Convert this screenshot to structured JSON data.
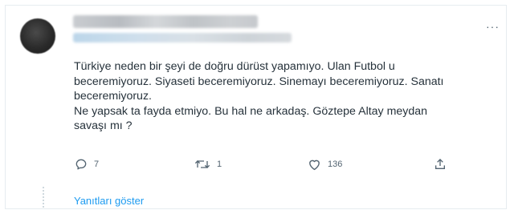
{
  "tweet": {
    "more_icon_glyph": "···",
    "text_lines": [
      "Türkiye neden bir şeyi de doğru dürüst yapamıyo. Ulan Futbol u",
      "beceremiyoruz. Siyaseti beceremiyoruz. Sinemayı beceremiyoruz. Sanatı",
      "beceremiyoruz.",
      "Ne yapsak ta fayda etmiyo. Bu hal ne arkadaş. Göztepe Altay meydan",
      "savaşı mı ?"
    ],
    "actions": {
      "reply_count": "7",
      "retweet_count": "1",
      "like_count": "136",
      "share_icon": "share-icon"
    },
    "show_replies_label": "Yanıtları göster"
  },
  "colors": {
    "accent": "#1d9bf0",
    "icon_gray": "#536471",
    "text": "#26323b"
  }
}
